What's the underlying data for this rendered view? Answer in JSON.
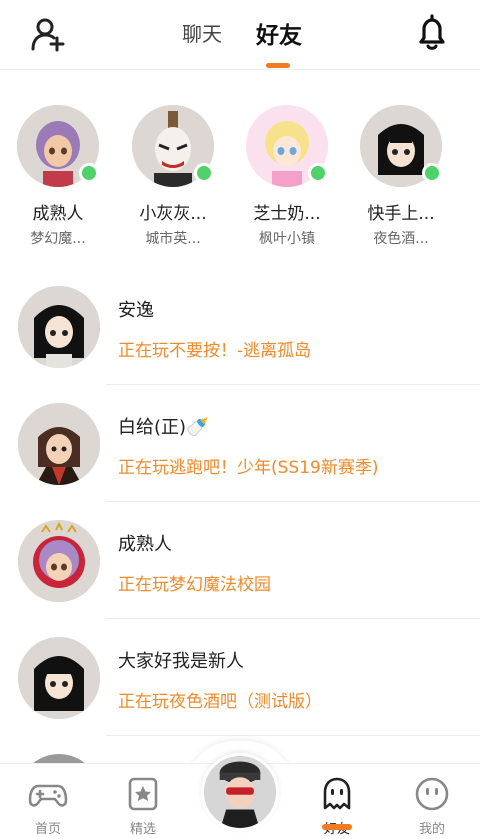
{
  "header": {
    "tabs": [
      {
        "label": "聊天",
        "active": false
      },
      {
        "label": "好友",
        "active": true
      }
    ],
    "accent_color": "#f07b22"
  },
  "online_friends": [
    {
      "name": "成熟人",
      "game": "梦幻魔...",
      "online": true
    },
    {
      "name": "小灰灰...",
      "game": "城市英...",
      "online": true
    },
    {
      "name": "芝士奶...",
      "game": "枫叶小镇",
      "online": true
    },
    {
      "name": "快手上...",
      "game": "夜色酒...",
      "online": true
    }
  ],
  "friends": [
    {
      "name": "安逸",
      "status": "正在玩不要按！-逃离孤岛"
    },
    {
      "name": "白给(正)🍼",
      "status": "正在玩逃跑吧！少年(SS19新赛季)"
    },
    {
      "name": "成熟人",
      "status": "正在玩梦幻魔法校园"
    },
    {
      "name": "大家好我是新人",
      "status": "正在玩夜色酒吧（测试版）"
    }
  ],
  "bottom_nav": [
    {
      "label": "首页",
      "icon": "gamepad-icon"
    },
    {
      "label": "精选",
      "icon": "star-card-icon"
    },
    {
      "label": "",
      "icon": "player-avatar"
    },
    {
      "label": "好友",
      "icon": "ghost-icon",
      "active": true
    },
    {
      "label": "我的",
      "icon": "face-icon"
    }
  ],
  "colors": {
    "status_text": "#f08a2a",
    "online_dot": "#4fd26a"
  }
}
